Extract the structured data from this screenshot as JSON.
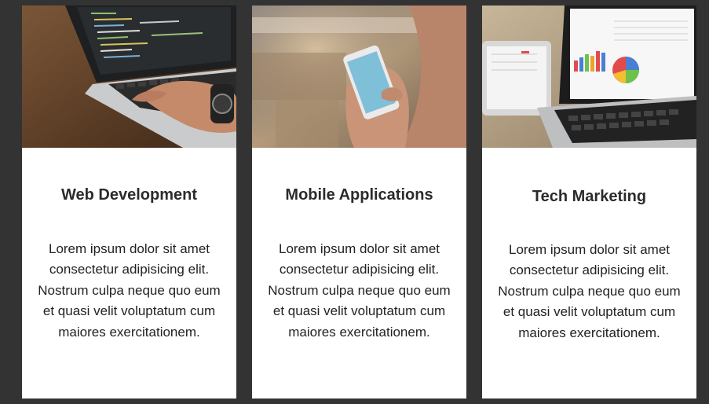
{
  "cards": [
    {
      "image": "laptop-coding-photo",
      "title": "Web Development",
      "text": "Lorem ipsum dolor sit amet consectetur adipisicing elit. Nostrum culpa neque quo eum et quasi velit voluptatum cum maiores exercitationem."
    },
    {
      "image": "smartphone-in-hand-photo",
      "title": "Mobile Applications",
      "text": "Lorem ipsum dolor sit amet consectetur adipisicing elit. Nostrum culpa neque quo eum et quasi velit voluptatum cum maiores exercitationem."
    },
    {
      "image": "laptop-charts-photo",
      "title": "Tech Marketing",
      "text": "Lorem ipsum dolor sit amet consectetur adipisicing elit. Nostrum culpa neque quo eum et quasi velit voluptatum cum maiores exercitationem."
    }
  ],
  "colors": {
    "background": "#333333",
    "card": "#ffffff",
    "title": "#2b2b2b",
    "text": "#222222"
  }
}
